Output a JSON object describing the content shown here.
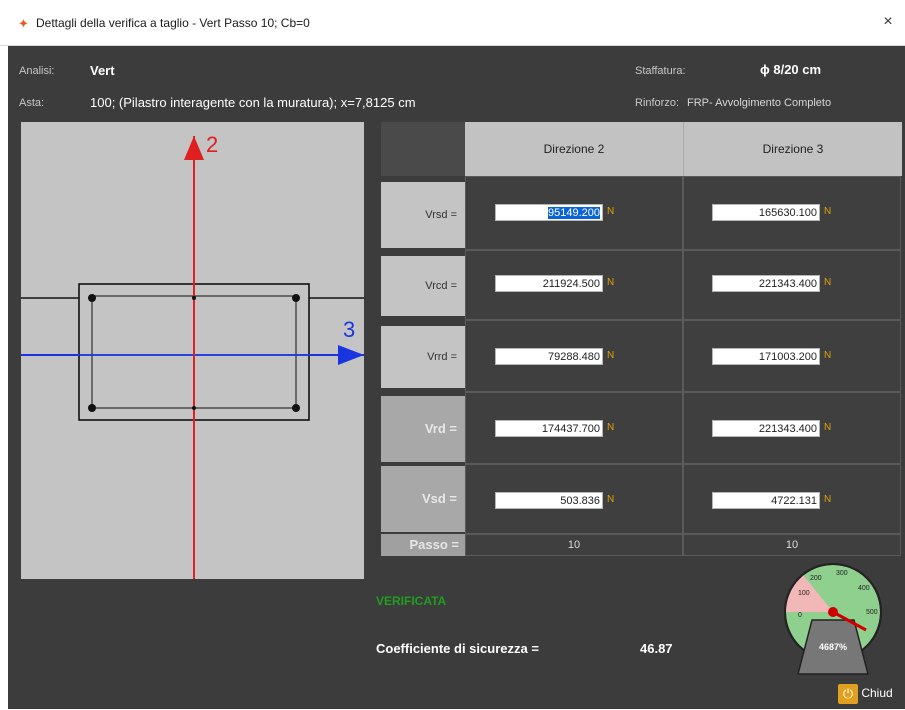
{
  "window": {
    "title": "Dettagli della verifica a taglio - Vert Passo 10; Cb=0",
    "close_glyph": "×"
  },
  "header": {
    "analisi_label": "Analisi:",
    "analisi_value": "Vert",
    "asta_label": "Asta:",
    "asta_value": "100; (Pilastro interagente con la muratura); x=7,8125 cm",
    "staffatura_label": "Staffatura:",
    "staffatura_value": "ϕ 8/20 cm",
    "rinforzo_label": "Rinforzo:",
    "rinforzo_value": "FRP- Avvolgimento Completo"
  },
  "section": {
    "axis2_label": "2",
    "axis3_label": "3"
  },
  "table": {
    "columns": [
      "Direzione 2",
      "Direzione 3"
    ],
    "unit": "N",
    "rows": [
      {
        "label": "Vrsd =",
        "d2": "95149.200",
        "d3": "165630.100"
      },
      {
        "label": "Vrcd =",
        "d2": "211924.500",
        "d3": "221343.400"
      },
      {
        "label": "Vrrd =",
        "d2": "79288.480",
        "d3": "171003.200"
      },
      {
        "label": "Vrd =",
        "d2": "174437.700",
        "d3": "221343.400"
      },
      {
        "label": "Vsd =",
        "d2": "503.836",
        "d3": "4722.131"
      }
    ],
    "passo_label": "Passo =",
    "passo_d2": "10",
    "passo_d3": "10"
  },
  "result": {
    "status": "VERIFICATA",
    "coef_label": "Coefficiente di sicurezza =",
    "coef_value": "46.87",
    "gauge_text": "4687%",
    "gauge_ticks": [
      "0",
      "100",
      "200",
      "300",
      "400",
      "500"
    ]
  },
  "footer": {
    "close_label": "Chiud"
  },
  "colors": {
    "accent": "#e0a020",
    "ok": "#1f9e1f",
    "axis2": "#e02020",
    "axis3": "#2040e0"
  }
}
